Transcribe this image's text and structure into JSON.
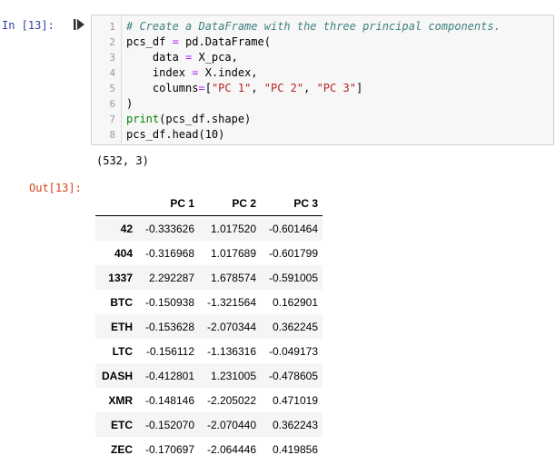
{
  "input_prompt": "In [13]:",
  "output_prompt": "Out[13]:",
  "code": {
    "line_numbers": [
      "1",
      "2",
      "3",
      "4",
      "5",
      "6",
      "7",
      "8"
    ],
    "comment": "# Create a DataFrame with the three principal components.",
    "l2_var": "pcs_df",
    "l2_eq": " = ",
    "l2_call": "pd.DataFrame(",
    "l3_key": "    data",
    "l3_eq": " = ",
    "l3_val": "X_pca,",
    "l4_key": "    index",
    "l4_eq": " = ",
    "l4_val": "X.index,",
    "l5_key": "    columns",
    "l5_eq": "=",
    "l5_open": "[",
    "l5_s1": "\"PC 1\"",
    "l5_c1": ", ",
    "l5_s2": "\"PC 2\"",
    "l5_c2": ", ",
    "l5_s3": "\"PC 3\"",
    "l5_close": "]",
    "l6": ")",
    "l7_builtin": "print",
    "l7_rest": "(pcs_df.shape)",
    "l8": "pcs_df.head(10)"
  },
  "shape_output": "(532, 3)",
  "table": {
    "columns": [
      "PC 1",
      "PC 2",
      "PC 3"
    ],
    "rows": [
      {
        "index": "42",
        "values": [
          "-0.333626",
          "1.017520",
          "-0.601464"
        ]
      },
      {
        "index": "404",
        "values": [
          "-0.316968",
          "1.017689",
          "-0.601799"
        ]
      },
      {
        "index": "1337",
        "values": [
          "2.292287",
          "1.678574",
          "-0.591005"
        ]
      },
      {
        "index": "BTC",
        "values": [
          "-0.150938",
          "-1.321564",
          "0.162901"
        ]
      },
      {
        "index": "ETH",
        "values": [
          "-0.153628",
          "-2.070344",
          "0.362245"
        ]
      },
      {
        "index": "LTC",
        "values": [
          "-0.156112",
          "-1.136316",
          "-0.049173"
        ]
      },
      {
        "index": "DASH",
        "values": [
          "-0.412801",
          "1.231005",
          "-0.478605"
        ]
      },
      {
        "index": "XMR",
        "values": [
          "-0.148146",
          "-2.205022",
          "0.471019"
        ]
      },
      {
        "index": "ETC",
        "values": [
          "-0.152070",
          "-2.070440",
          "0.362243"
        ]
      },
      {
        "index": "ZEC",
        "values": [
          "-0.170697",
          "-2.064446",
          "0.419856"
        ]
      }
    ]
  },
  "icons": {
    "run_cell": "run-cell-icon"
  },
  "colors": {
    "in_prompt": "#303f9f",
    "out_prompt": "#d84315",
    "comment": "#408080",
    "operator": "#aa22ff",
    "string": "#ba2121",
    "builtin": "#008000"
  }
}
